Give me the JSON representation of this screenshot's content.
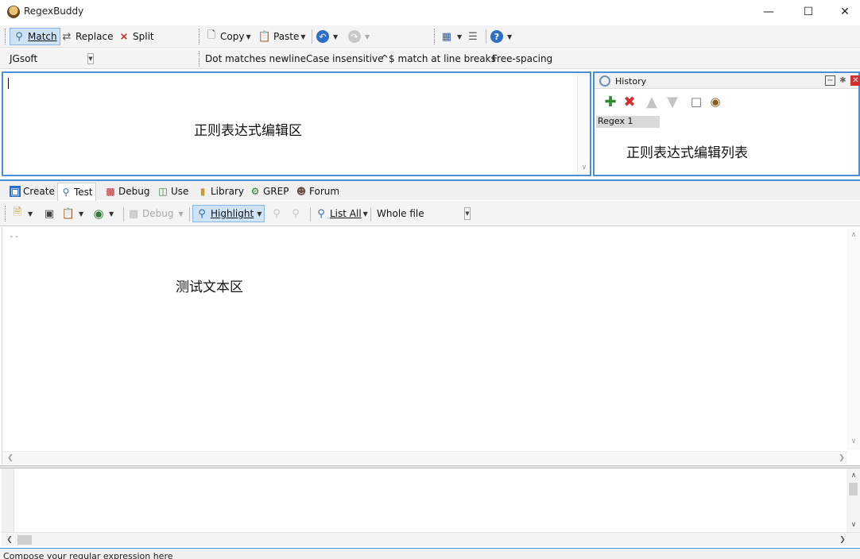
{
  "window": {
    "title": "RegexBuddy"
  },
  "toolbar": {
    "match": "Match",
    "replace": "Replace",
    "split": "Split",
    "copy": "Copy",
    "paste": "Paste"
  },
  "options": {
    "flavor": "JGsoft",
    "dot_newline": "Dot matches newline",
    "case_insensitive": "Case insensitive",
    "line_breaks": "^$ match at line breaks",
    "free_spacing": "Free-spacing"
  },
  "regex_panel": {
    "annotation": "正则表达式编辑区"
  },
  "history": {
    "title": "History",
    "items": [
      "Regex 1"
    ],
    "annotation": "正则表达式编辑列表"
  },
  "tabs": [
    "Create",
    "Test",
    "Debug",
    "Use",
    "Library",
    "GREP",
    "Forum"
  ],
  "test_toolbar": {
    "debug": "Debug",
    "highlight": "Highlight",
    "list_all": "List All",
    "scope": "Whole file"
  },
  "test_panel": {
    "text": "--",
    "annotation": "测试文本区"
  },
  "status": {
    "text": "Compose your regular expression here"
  },
  "colors": {
    "accent": "#4a90d9",
    "active_button": "#cfe3f7"
  }
}
